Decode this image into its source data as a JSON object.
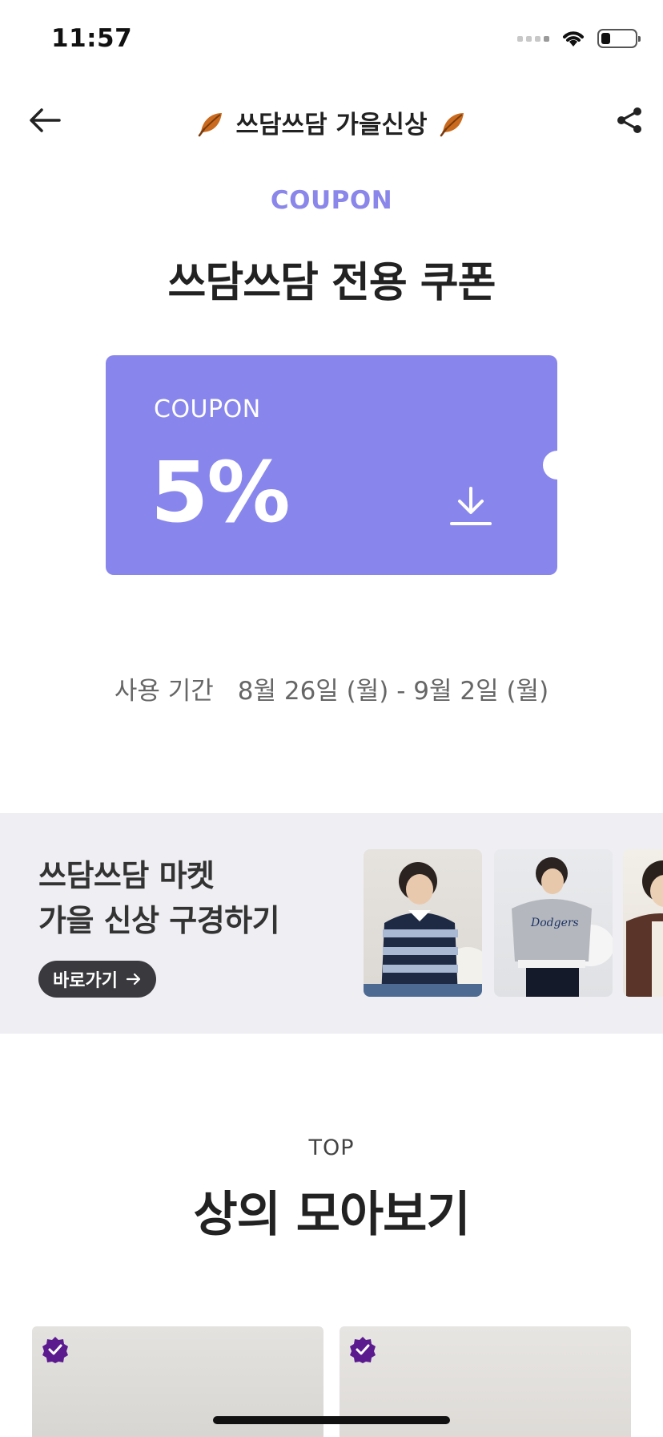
{
  "status_bar": {
    "time": "11:57",
    "battery_level": 0.25,
    "icons": [
      "signal-icon",
      "wifi-icon",
      "battery-icon"
    ]
  },
  "nav": {
    "title": "쓰담쓰담 가을신상",
    "back_icon": "back-arrow-icon",
    "share_icon": "share-icon",
    "title_decoration_icon": "autumn-leaf-icon"
  },
  "coupon_section": {
    "eyebrow": "COUPON",
    "heading": "쓰담쓰담 전용 쿠폰",
    "card": {
      "label": "COUPON",
      "value": "5%",
      "color": "#8886ed",
      "download_icon": "download-icon"
    },
    "period_label": "사용 기간",
    "period_value": "8월 26일 (월) - 9월 2일 (월)"
  },
  "promo_banner": {
    "line1": "쓰담쓰담 마켓",
    "line2": "가을 신상 구경하기",
    "button_label": "바로가기",
    "button_icon": "arrow-right-icon",
    "background": "#efeff3",
    "thumbnails": [
      "product-photo",
      "product-photo",
      "product-photo"
    ]
  },
  "top_section": {
    "eyebrow": "TOP",
    "heading": "상의 모아보기",
    "products": [
      {
        "badge_icon": "verified-badge-icon"
      },
      {
        "badge_icon": "verified-badge-icon"
      }
    ]
  },
  "colors": {
    "accent": "#8a86ea",
    "badge": "#5b1b8f",
    "button_dark": "#3a3a3e"
  }
}
